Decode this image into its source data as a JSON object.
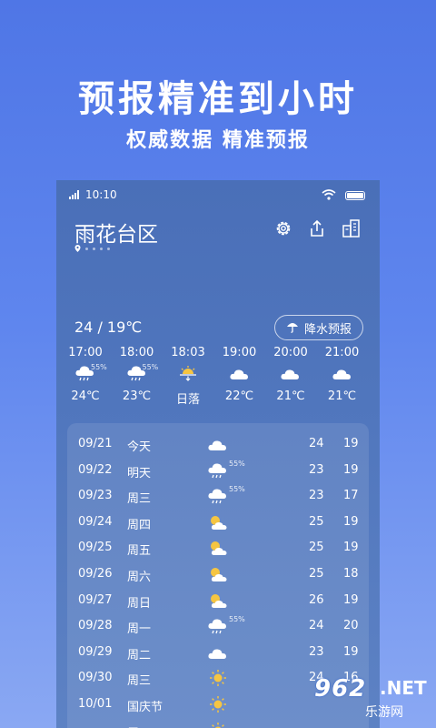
{
  "promo": {
    "headline": "预报精准到小时",
    "subheadline": "权威数据 精准预报"
  },
  "status_bar": {
    "network": "4G",
    "time": "10:10"
  },
  "location": {
    "name": "雨花台区",
    "page_dots": 4
  },
  "top_actions": [
    {
      "name": "settings",
      "icon": "gear-icon"
    },
    {
      "name": "share",
      "icon": "share-icon"
    },
    {
      "name": "cities",
      "icon": "city-buildings-icon"
    }
  ],
  "today": {
    "temp_range": "24 / 19℃",
    "rain_forecast_label": "降水预报"
  },
  "hourly": [
    {
      "time": "17:00",
      "icon": "cloud-rain-icon",
      "pop": "55%",
      "value": "24℃"
    },
    {
      "time": "18:00",
      "icon": "cloud-rain-icon",
      "pop": "55%",
      "value": "23℃"
    },
    {
      "time": "18:03",
      "icon": "sunset-icon",
      "pop": "",
      "value": "日落"
    },
    {
      "time": "19:00",
      "icon": "cloud-icon",
      "pop": "",
      "value": "22℃"
    },
    {
      "time": "20:00",
      "icon": "cloud-icon",
      "pop": "",
      "value": "21℃"
    },
    {
      "time": "21:00",
      "icon": "cloud-icon",
      "pop": "",
      "value": "21℃"
    }
  ],
  "daily": [
    {
      "date": "09/21",
      "weekday": "今天",
      "icon": "cloud-icon",
      "pop": "",
      "high": "24",
      "low": "19"
    },
    {
      "date": "09/22",
      "weekday": "明天",
      "icon": "cloud-rain-icon",
      "pop": "55%",
      "high": "23",
      "low": "19"
    },
    {
      "date": "09/23",
      "weekday": "周三",
      "icon": "cloud-rain-icon",
      "pop": "55%",
      "high": "23",
      "low": "17"
    },
    {
      "date": "09/24",
      "weekday": "周四",
      "icon": "partly-cloudy-icon",
      "pop": "",
      "high": "25",
      "low": "19"
    },
    {
      "date": "09/25",
      "weekday": "周五",
      "icon": "partly-cloudy-icon",
      "pop": "",
      "high": "25",
      "low": "19"
    },
    {
      "date": "09/26",
      "weekday": "周六",
      "icon": "partly-cloudy-icon",
      "pop": "",
      "high": "25",
      "low": "18"
    },
    {
      "date": "09/27",
      "weekday": "周日",
      "icon": "partly-cloudy-icon",
      "pop": "",
      "high": "26",
      "low": "19"
    },
    {
      "date": "09/28",
      "weekday": "周一",
      "icon": "cloud-rain-icon",
      "pop": "55%",
      "high": "24",
      "low": "20"
    },
    {
      "date": "09/29",
      "weekday": "周二",
      "icon": "cloud-icon",
      "pop": "",
      "high": "23",
      "low": "19"
    },
    {
      "date": "09/30",
      "weekday": "周三",
      "icon": "sun-icon",
      "pop": "",
      "high": "24",
      "low": "16"
    },
    {
      "date": "10/01",
      "weekday": "国庆节",
      "icon": "sun-icon",
      "pop": "",
      "high": "",
      "low": ""
    },
    {
      "date": "",
      "weekday": "周五",
      "icon": "sun-icon",
      "pop": "",
      "high": "",
      "low": ""
    }
  ],
  "watermark": {
    "number": "962",
    "suffix": ".NET",
    "site": "乐游网"
  },
  "colors": {
    "bg_top": "#4f76e6",
    "bg_bottom": "#8aa8f3",
    "card": "#4a6fb8",
    "sun": "#f5c542"
  }
}
